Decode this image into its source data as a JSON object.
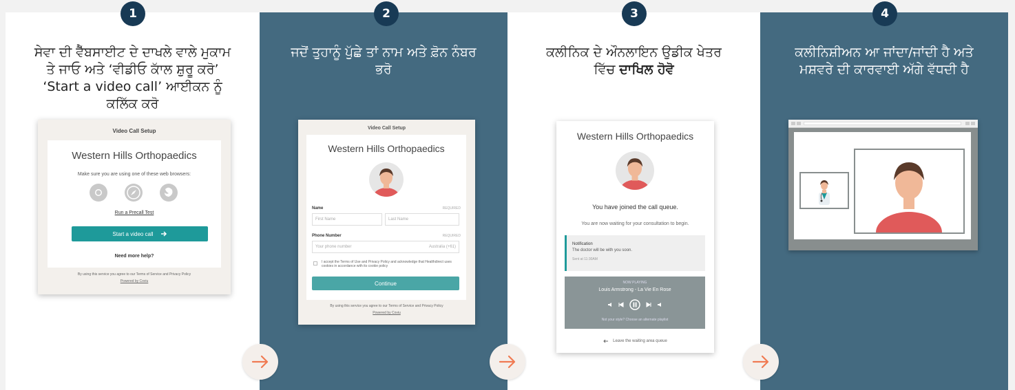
{
  "steps": [
    {
      "number": "1",
      "text": "ਸੇਵਾ ਦੀ ਵੈੱਬਸਾਈਟ ਦੇ ਦਾਖਲੇ ਵਾਲੇ ਮੁਕਾਮ ਤੇ ਜਾਓ ਅਤੇ ‘ਵੀਡੀਓ ਕਾੱਲ ਸ਼ੁਰੂ ਕਰੋ’ ‘Start a video call’ ਆਈਕਨ ਨੂੰ ਕਲਿੱਕ ਕਰੋ"
    },
    {
      "number": "2",
      "text": "ਜਦੋਂ ਤੁਹਾਨੂੰ ਪੁੱਛੇ ਤਾਂ ਨਾਮ ਅਤੇ ਫ਼ੋਨ ਨੰਬਰ ਭਰੋ"
    },
    {
      "number": "3",
      "text_before": "ਕਲੀਨਿਕ ਦੇ ਔਨਲਾਇਨ ਉਡੀਕ ਖੇਤਰ ਵਿੱਚ ",
      "text_bold": "ਦਾਖਿਲ ਹੋਵੋ"
    },
    {
      "number": "4",
      "text": "ਕਲੀਨਿਸ਼ੀਅਨ ਆ ਜਾਂਦਾ/ਜਾਂਦੀ ਹੈ ਅਤੇ ਮਸ਼ਵਰੇ ਦੀ ਕਾਰਵਾਈ ਅੱਗੇ ਵੱਧਦੀ ਹੈ"
    }
  ],
  "colors": {
    "accent_teal": "#1e9a9a",
    "panel_blue": "#446a80",
    "badge_navy": "#183a55",
    "arrow_orange": "#f07a52"
  },
  "card1": {
    "header": "Video Call Setup",
    "clinic": "Western Hills Orthopaedics",
    "browsers_note": "Make sure you are using one of these web browsers:",
    "precall_link": "Run a Precall Test",
    "start_button": "Start a video call",
    "help": "Need more help?",
    "footer": "By using this service you agree to our Terms of Service and Privacy Policy",
    "powered": "Powered by Coviu"
  },
  "card2": {
    "header": "Video Call Setup",
    "clinic": "Western Hills Orthopaedics",
    "name_label": "Name",
    "required1": "REQUIRED",
    "first_placeholder": "First Name",
    "last_placeholder": "Last Name",
    "phone_label": "Phone Number",
    "required2": "REQUIRED",
    "phone_placeholder": "Your phone number",
    "country": "Australia (+61)",
    "consent": "I accept the Terms of Use and Privacy Policy and acknowledge that Healthdirect uses cookies in accordance with its cookie policy",
    "continue": "Continue",
    "footer": "By using this service you agree to our Terms of Service and Privacy Policy",
    "powered": "Powered by Coviu"
  },
  "card3": {
    "clinic": "Western Hills Orthopaedics",
    "joined": "You have joined the call queue.",
    "waiting": "You are now waiting for your consultation to begin.",
    "notif_title": "Notification",
    "notif_text": "The doctor will be with you soon.",
    "notif_time": "Sent at 11:30AM",
    "now_playing": "NOW PLAYING",
    "track": "Louis Armstrong - La Vie En Rose",
    "style_note": "Not your style? Choose an alternate playlist",
    "leave": "Leave the waiting area queue"
  }
}
